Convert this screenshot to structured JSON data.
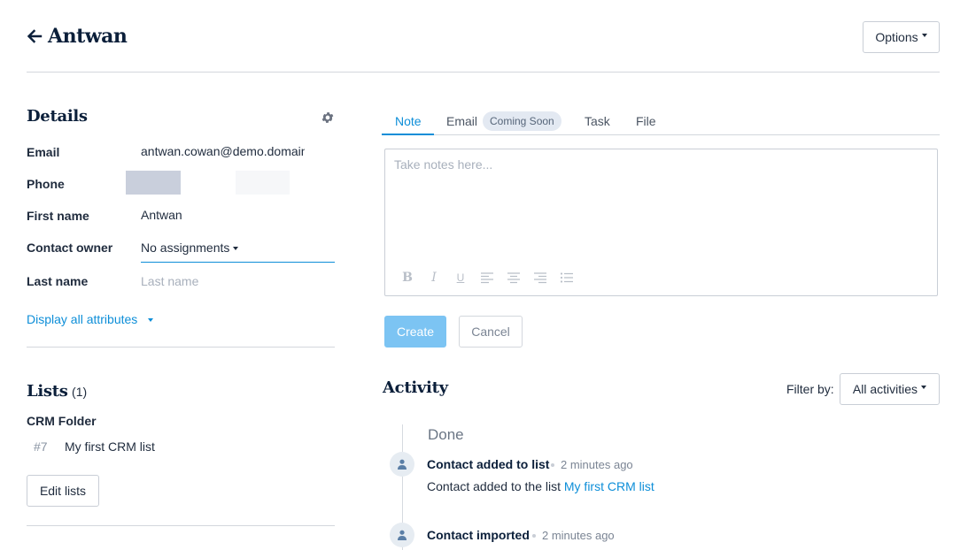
{
  "header": {
    "title": "Antwan",
    "options_label": "Options"
  },
  "details": {
    "title": "Details",
    "fields": [
      {
        "label": "Email",
        "value": "antwan.cowan@demo.domain"
      },
      {
        "label": "Phone",
        "value": ""
      },
      {
        "label": "First name",
        "value": "Antwan"
      },
      {
        "label": "Contact owner",
        "value": "No assignments"
      },
      {
        "label": "Last name",
        "placeholder": "Last name"
      }
    ],
    "display_all": "Display all attributes"
  },
  "lists": {
    "title": "Lists",
    "count": "(1)",
    "folder": "CRM Folder",
    "items": [
      {
        "id": "#7",
        "name": "My first CRM list"
      }
    ],
    "edit_label": "Edit lists"
  },
  "composer": {
    "tabs": [
      {
        "label": "Note",
        "active": true
      },
      {
        "label": "Email"
      },
      {
        "label": "Task"
      },
      {
        "label": "File"
      }
    ],
    "coming_soon": "Coming Soon",
    "placeholder": "Take notes here...",
    "create_label": "Create",
    "cancel_label": "Cancel"
  },
  "activity": {
    "title": "Activity",
    "filter_label": "Filter by:",
    "filter_value": "All activities",
    "group": "Done",
    "items": [
      {
        "title": "Contact added to list",
        "time": "2 minutes ago",
        "desc": "Contact added to the list ",
        "link": "My first CRM list"
      },
      {
        "title": "Contact imported",
        "time": "2 minutes ago"
      }
    ]
  },
  "colors": {
    "accent": "#0d8ed8",
    "create_disabled": "#7cc4f3",
    "navy": "#0b1f3a"
  }
}
